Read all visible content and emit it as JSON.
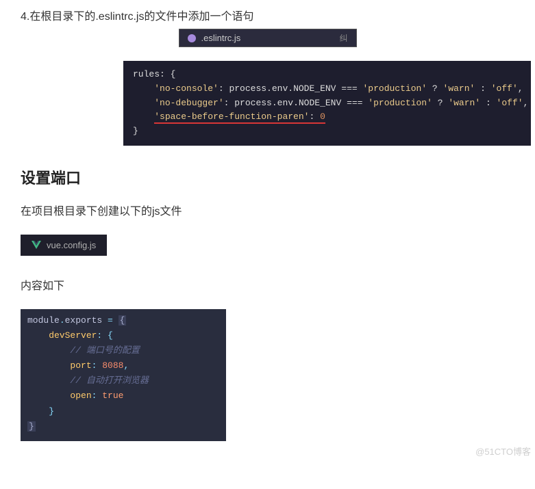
{
  "step4": {
    "text": "4.在根目录下的.eslintrc.js的文件中添加一个语句"
  },
  "eslintTab": {
    "filename": ".eslintrc.js",
    "right": "纠"
  },
  "codeBlock1": {
    "line1_prefix": "rules: ",
    "line1_brace": "{",
    "line2_key": "'no-console'",
    "line2_colon": ": ",
    "line2_expr": "process.env.NODE_ENV ",
    "line2_eq": "=== ",
    "line2_val1": "'production'",
    "line2_tern": " ? ",
    "line2_val2": "'warn'",
    "line2_tern2": " : ",
    "line2_val3": "'off'",
    "line2_comma": ",",
    "line3_key": "'no-debugger'",
    "line3_colon": ": ",
    "line3_expr": "process.env.NODE_ENV ",
    "line3_eq": "=== ",
    "line3_val1": "'production'",
    "line3_tern": " ? ",
    "line3_val2": "'warn'",
    "line3_tern2": " : ",
    "line3_val3": "'off'",
    "line3_comma": ",",
    "line4_key": "'space-before-function-paren'",
    "line4_colon": ": ",
    "line4_val": "0",
    "line5_brace": "}"
  },
  "heading1": "设置端口",
  "desc1": "在项目根目录下创建以下的js文件",
  "vueTab": {
    "filename": "vue.config.js"
  },
  "desc2": "内容如下",
  "codeBlock2": {
    "l1_a": "module",
    "l1_b": ".",
    "l1_c": "exports",
    "l1_d": " = ",
    "l1_e": "{",
    "l2_a": "    devServer",
    "l2_b": ": {",
    "l3": "        // 端口号的配置",
    "l4_a": "        port",
    "l4_b": ": ",
    "l4_c": "8088",
    "l4_d": ",",
    "l5": "        // 自动打开浏览器",
    "l6_a": "        open",
    "l6_b": ": ",
    "l6_c": "true",
    "l7": "    }",
    "l8": "}"
  },
  "watermark": "@51CTO博客"
}
